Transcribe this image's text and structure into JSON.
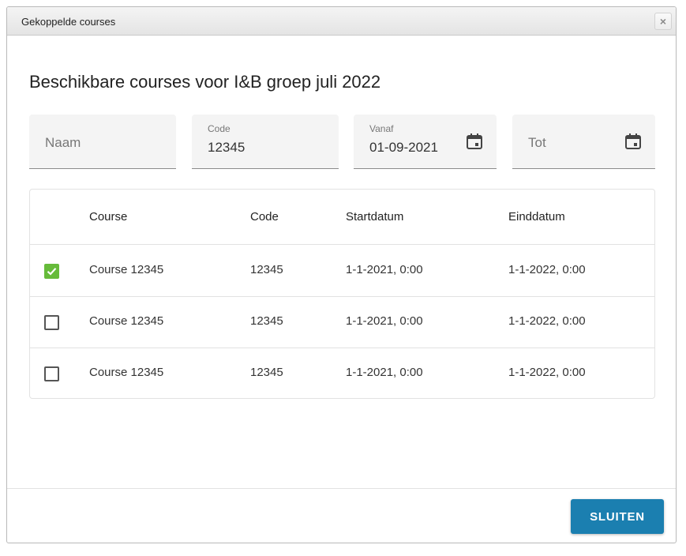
{
  "dialog": {
    "title": "Gekoppelde courses",
    "close_icon": "close-icon"
  },
  "heading": "Beschikbare courses voor I&B groep juli 2022",
  "filters": {
    "naam": {
      "placeholder": "Naam",
      "value": ""
    },
    "code": {
      "label": "Code",
      "value": "12345"
    },
    "vanaf": {
      "label": "Vanaf",
      "value": "01-09-2021",
      "icon": "calendar-icon"
    },
    "tot": {
      "placeholder": "Tot",
      "value": "",
      "icon": "calendar-icon"
    }
  },
  "table": {
    "columns": [
      "Course",
      "Code",
      "Startdatum",
      "Einddatum"
    ],
    "rows": [
      {
        "checked": true,
        "course": "Course 12345",
        "code": "12345",
        "start": "1-1-2021, 0:00",
        "end": "1-1-2022, 0:00"
      },
      {
        "checked": false,
        "course": "Course 12345",
        "code": "12345",
        "start": "1-1-2021, 0:00",
        "end": "1-1-2022, 0:00"
      },
      {
        "checked": false,
        "course": "Course 12345",
        "code": "12345",
        "start": "1-1-2021, 0:00",
        "end": "1-1-2022, 0:00"
      }
    ]
  },
  "footer": {
    "close_label": "SLUITEN"
  },
  "colors": {
    "accent": "#1b7fb0",
    "check": "#66bb3a"
  }
}
